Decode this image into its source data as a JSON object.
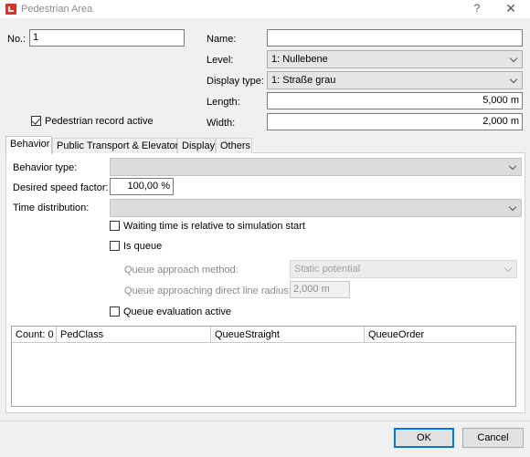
{
  "window": {
    "title": "Pedestrian Area",
    "help": "?",
    "close": "✕"
  },
  "header": {
    "no_label": "No.:",
    "no_value": "1",
    "name_label": "Name:",
    "name_value": "",
    "level_label": "Level:",
    "level_value": "1: Nullebene",
    "display_type_label": "Display type:",
    "display_type_value": "1: Straße grau",
    "length_label": "Length:",
    "length_value": "5,000 m",
    "width_label": "Width:",
    "width_value": "2,000 m",
    "ped_record_label": "Pedestrian record active",
    "ped_record_checked": true
  },
  "tabs": [
    {
      "label": "Behavior",
      "active": true
    },
    {
      "label": "Public Transport & Elevators",
      "active": false
    },
    {
      "label": "Display",
      "active": false
    },
    {
      "label": "Others",
      "active": false
    }
  ],
  "behavior": {
    "behavior_type_label": "Behavior type:",
    "behavior_type_value": "",
    "desired_speed_label": "Desired speed factor:",
    "desired_speed_value": "100,00 %",
    "time_distribution_label": "Time distribution:",
    "time_distribution_value": "",
    "waiting_time_label": "Waiting time is relative to simulation start",
    "is_queue_label": "Is queue",
    "queue_method_label": "Queue approach method:",
    "queue_method_value": "Static potential",
    "queue_radius_label": "Queue approaching direct line radius:",
    "queue_radius_value": "2,000 m",
    "queue_eval_label": "Queue evaluation active"
  },
  "queue_table": {
    "columns": [
      "Count: 0",
      "PedClass",
      "QueueStraight",
      "QueueOrder"
    ]
  },
  "footer": {
    "ok_label": "OK",
    "cancel_label": "Cancel"
  },
  "colors": {
    "accent": "#0078d7",
    "app_icon": "#d9352a"
  }
}
